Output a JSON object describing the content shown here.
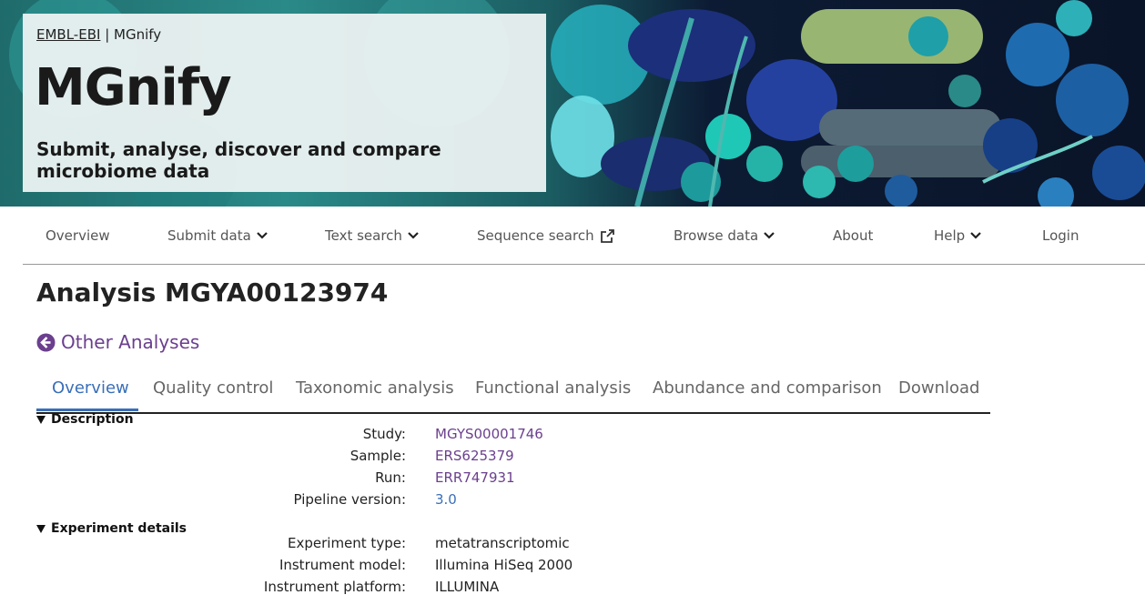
{
  "hero": {
    "breadcrumb_org": "EMBL-EBI",
    "breadcrumb_sep": "|",
    "breadcrumb_site": "MGnify",
    "logo_text": "MGnify",
    "tagline": "Submit, analyse, discover and compare microbiome data"
  },
  "nav": {
    "items": [
      {
        "label": "Overview"
      },
      {
        "label": "Submit data",
        "icon": "chevron-down-icon"
      },
      {
        "label": "Text search",
        "icon": "chevron-down-icon"
      },
      {
        "label": "Sequence search",
        "icon": "external-link-icon"
      },
      {
        "label": "Browse data",
        "icon": "chevron-down-icon"
      },
      {
        "label": "About"
      },
      {
        "label": "Help",
        "icon": "chevron-down-icon"
      },
      {
        "label": "Login"
      }
    ]
  },
  "page": {
    "title": "Analysis MGYA00123974",
    "back_link": "Other Analyses",
    "back_icon": "arrow-circle-left-icon"
  },
  "tabs": [
    {
      "label": "Overview",
      "active": true
    },
    {
      "label": "Quality control"
    },
    {
      "label": "Taxonomic analysis"
    },
    {
      "label": "Functional analysis"
    },
    {
      "label": "Abundance and comparison"
    },
    {
      "label": "Download"
    }
  ],
  "description": {
    "heading": "Description",
    "rows": [
      {
        "label": "Study:",
        "value": "MGYS00001746"
      },
      {
        "label": "Sample:",
        "value": "ERS625379"
      },
      {
        "label": "Run:",
        "value": "ERR747931"
      },
      {
        "label": "Pipeline version:",
        "value": "3.0"
      }
    ]
  },
  "experiment": {
    "heading": "Experiment details",
    "rows": [
      {
        "label": "Experiment type:",
        "value": "metatranscriptomic"
      },
      {
        "label": "Instrument model:",
        "value": "Illumina HiSeq 2000"
      },
      {
        "label": "Instrument platform:",
        "value": "ILLUMINA"
      }
    ]
  },
  "colors": {
    "link_purple": "#6b3f8e",
    "active_blue": "#3a6fb8",
    "hero_dark": "#0c1b33",
    "hero_teal": "#2a8a88"
  }
}
